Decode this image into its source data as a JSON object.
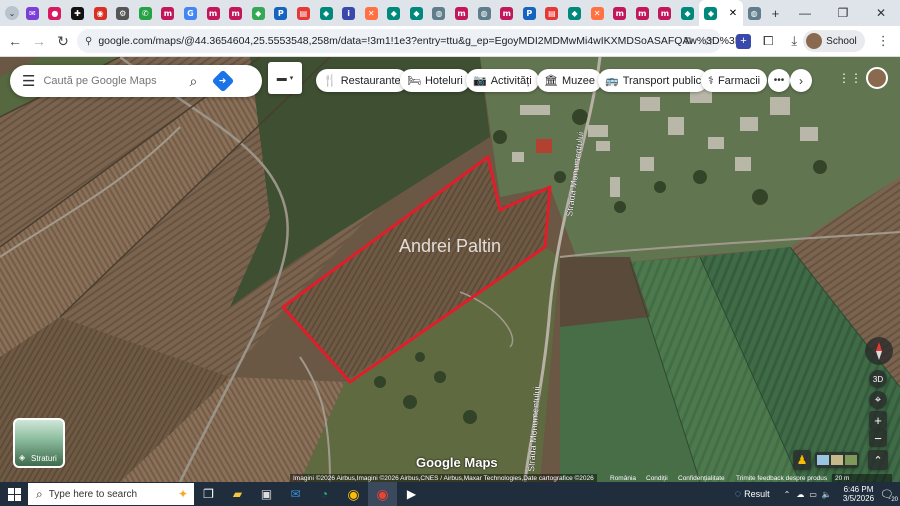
{
  "browser": {
    "tab_favicons": [
      {
        "name": "mail",
        "color": "#7b3fd6",
        "glyph": "✉"
      },
      {
        "name": "pink-app",
        "color": "#d81b60",
        "glyph": "●"
      },
      {
        "name": "plus-app",
        "color": "#111111",
        "glyph": "✚"
      },
      {
        "name": "record",
        "color": "#d93025",
        "glyph": "◉"
      },
      {
        "name": "settings",
        "color": "#555555",
        "glyph": "⚙"
      },
      {
        "name": "whatsapp",
        "color": "#25a244",
        "glyph": "✆"
      },
      {
        "name": "m-app",
        "color": "#c2185b",
        "glyph": "m"
      },
      {
        "name": "google",
        "color": "#4285f4",
        "glyph": "G"
      },
      {
        "name": "m-app",
        "color": "#c2185b",
        "glyph": "m"
      },
      {
        "name": "m-app",
        "color": "#c2185b",
        "glyph": "m"
      },
      {
        "name": "maps",
        "color": "#34a853",
        "glyph": "◆"
      },
      {
        "name": "p-app",
        "color": "#1565c0",
        "glyph": "P"
      },
      {
        "name": "news",
        "color": "#e53935",
        "glyph": "▤"
      },
      {
        "name": "meet",
        "color": "#00897b",
        "glyph": "◆"
      },
      {
        "name": "info",
        "color": "#3949ab",
        "glyph": "i"
      },
      {
        "name": "x-app",
        "color": "#ff7043",
        "glyph": "✕"
      },
      {
        "name": "meet",
        "color": "#00897b",
        "glyph": "◆"
      },
      {
        "name": "meet",
        "color": "#00897b",
        "glyph": "◆"
      },
      {
        "name": "globe",
        "color": "#607d8b",
        "glyph": "◍"
      },
      {
        "name": "m-app",
        "color": "#c2185b",
        "glyph": "m"
      },
      {
        "name": "globe",
        "color": "#607d8b",
        "glyph": "◍"
      },
      {
        "name": "m-app",
        "color": "#c2185b",
        "glyph": "m"
      },
      {
        "name": "p-app",
        "color": "#1565c0",
        "glyph": "P"
      },
      {
        "name": "news",
        "color": "#e53935",
        "glyph": "▤"
      },
      {
        "name": "meet",
        "color": "#00897b",
        "glyph": "◆"
      },
      {
        "name": "x-app",
        "color": "#ff7043",
        "glyph": "✕"
      },
      {
        "name": "m-app",
        "color": "#c2185b",
        "glyph": "m"
      },
      {
        "name": "m-app",
        "color": "#c2185b",
        "glyph": "m"
      },
      {
        "name": "m-app",
        "color": "#c2185b",
        "glyph": "m"
      },
      {
        "name": "meet",
        "color": "#00897b",
        "glyph": "◆"
      }
    ],
    "active_tab_close": "✕",
    "after_tab_favicon": {
      "name": "globe",
      "color": "#607d8b",
      "glyph": "◍"
    },
    "new_tab": "+",
    "window_controls": {
      "minimize": "—",
      "restore": "❐",
      "close": "✕"
    },
    "url": "google.com/maps/@44.3654604,25.5553548,258m/data=!3m1!1e3?entry=ttu&g_ep=EgoyMDI2MDMwMi4wIKXMDSoASAFQAw%3D%3D",
    "profile_label": "School"
  },
  "maps": {
    "search_placeholder": "Caută pe Google Maps",
    "chips": [
      {
        "label": "Restaurante",
        "icon": "fork-knife-icon",
        "glyph": "🍴"
      },
      {
        "label": "Hoteluri",
        "icon": "bed-icon",
        "glyph": "🛏"
      },
      {
        "label": "Activități",
        "icon": "camera-icon",
        "glyph": "📷"
      },
      {
        "label": "Muzee",
        "icon": "museum-icon",
        "glyph": "🏛"
      },
      {
        "label": "Transport public",
        "icon": "bus-icon",
        "glyph": "🚌"
      },
      {
        "label": "Farmacii",
        "icon": "pharmacy-icon",
        "glyph": "⚕"
      }
    ],
    "place_label": "Andrei Paltin",
    "street_labels": [
      "Strada Monumentului",
      "Strada Monumentului"
    ],
    "layers_label": "Straturi",
    "button_3d": "3D",
    "logo": "Google Maps",
    "attribution": "Imagini ©2026 Airbus,Imagini ©2026 Airbus,CNES / Airbus,Maxar Technologies,Date cartografice ©2026",
    "footer_links": [
      "România",
      "Condiții",
      "Confidențialitate",
      "Trimite feedback despre produs"
    ],
    "scale": "20 m",
    "boundary_color": "#e11d2a"
  },
  "taskbar": {
    "search_placeholder": "Type here to search",
    "weather": "Result",
    "time": "6:46 PM",
    "date": "3/5/2026",
    "notification_count": "20"
  }
}
